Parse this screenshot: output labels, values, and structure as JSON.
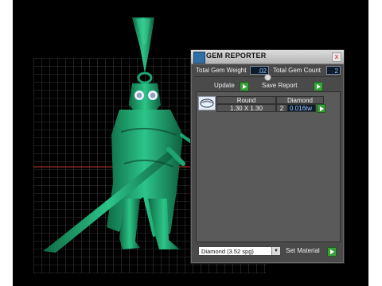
{
  "panel": {
    "title": "GEM REPORTER",
    "close_glyph": "x"
  },
  "stats": {
    "total_weight_label": "Total Gem Weight",
    "total_weight_value": ".02",
    "total_count_label": "Total Gem Count",
    "total_count_value": "2"
  },
  "actions": {
    "update_label": "Update",
    "save_report_label": "Save Report"
  },
  "gem_table": {
    "shape": "Round",
    "material": "Diamond",
    "size": "1.30 X 1.30",
    "count": "2",
    "weight": "0.016tw"
  },
  "bottom_bar": {
    "material_selected": "Diamond     (3.52 spg)",
    "set_material_label": "Set Material"
  },
  "colors": {
    "model_green": "#1e9a6a",
    "panel_bg": "#4a4a4a",
    "accent_go": "#3aa13a"
  },
  "icons": [
    "app-icon",
    "close-icon",
    "go-arrow-icon",
    "gem-round-icon",
    "dropdown-arrow-icon"
  ]
}
